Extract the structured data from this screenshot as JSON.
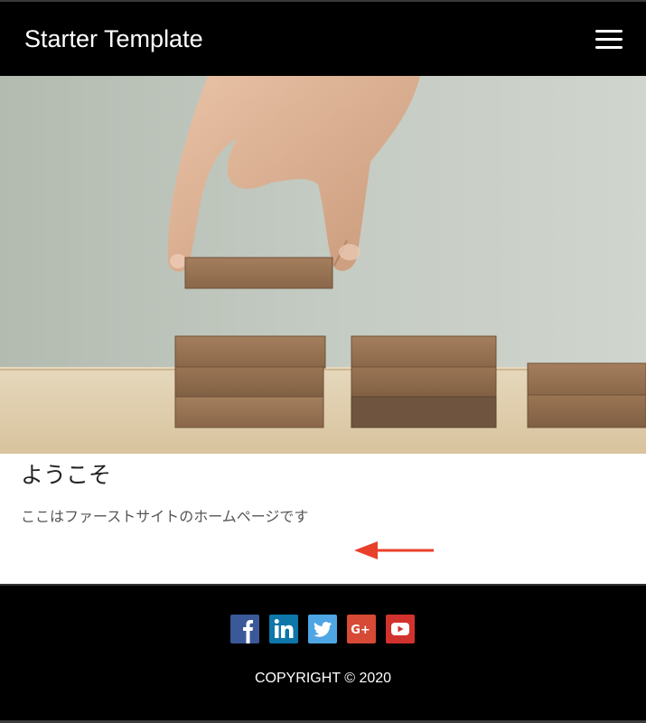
{
  "header": {
    "brand": "Starter Template",
    "menu_icon": "hamburger-menu-icon"
  },
  "hero": {
    "image_subject": "hand stacking wooden blocks"
  },
  "main": {
    "title": "ようこそ",
    "text": "ここはファーストサイトのホームページです",
    "arrow_color": "#e8402a"
  },
  "footer": {
    "social": [
      {
        "icon": "facebook-icon",
        "color": "#3b5998"
      },
      {
        "icon": "linkedin-icon",
        "color": "#0e76a8"
      },
      {
        "icon": "twitter-icon",
        "color": "#4ea6e4"
      },
      {
        "icon": "google-plus-icon",
        "color": "#d64a36"
      },
      {
        "icon": "youtube-icon",
        "color": "#d2322d"
      }
    ],
    "copyright": "COPYRIGHT © 2020"
  },
  "colors": {
    "navbar_bg": "#000000",
    "footer_bg": "#000000",
    "text_dark": "#222222",
    "text_muted": "#555555"
  }
}
